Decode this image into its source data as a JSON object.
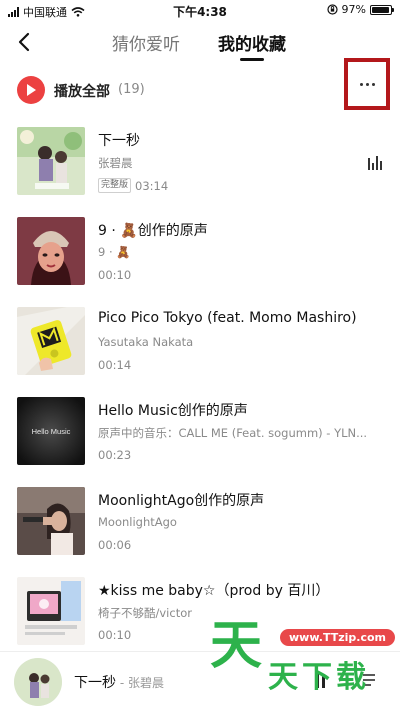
{
  "status_bar": {
    "carrier": "中国联通",
    "time": "下午4:38",
    "battery": "97%",
    "battery_level": 0.97
  },
  "nav": {
    "tabs": [
      {
        "label": "猜你爱听",
        "active": false
      },
      {
        "label": "我的收藏",
        "active": true
      }
    ]
  },
  "play_all": {
    "label": "播放全部",
    "count": "(19)"
  },
  "songs": [
    {
      "title": "下一秒",
      "artist": "张碧晨",
      "badge": "完整版",
      "duration": "03:14",
      "playing": true
    },
    {
      "title": "9 · 🧸创作的原声",
      "artist": "9 · 🧸",
      "badge": "",
      "duration": "00:10",
      "playing": false
    },
    {
      "title": "Pico Pico Tokyo (feat. Momo Mashiro)",
      "artist": "Yasutaka Nakata",
      "badge": "",
      "duration": "00:14",
      "playing": false
    },
    {
      "title": "Hello Music创作的原声",
      "artist": "原声中的音乐：CALL ME (Feat. sogumm) - YLN...",
      "badge": "",
      "duration": "00:23",
      "playing": false
    },
    {
      "title": "MoonlightAgo创作的原声",
      "artist": "MoonlightAgo",
      "badge": "",
      "duration": "00:06",
      "playing": false
    },
    {
      "title": "★kiss me baby☆（prod by 百川）",
      "artist": "椅子不够酷/victor",
      "badge": "",
      "duration": "00:10",
      "playing": false
    }
  ],
  "covers": {
    "hello_music_text": "Hello Music"
  },
  "mini_player": {
    "title": "下一秒",
    "separator": " - ",
    "artist": "张碧晨"
  },
  "watermark": {
    "url": "www.TTzip.com",
    "logo_big": "天",
    "logo_small": "天下载"
  },
  "colors": {
    "accent": "#ec4141",
    "highlight_box": "#b3181b",
    "watermark_green": "#2db24b"
  }
}
